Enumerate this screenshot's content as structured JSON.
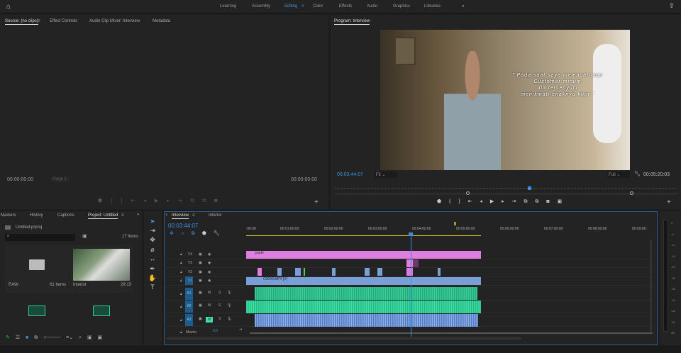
{
  "workspaces": [
    "Learning",
    "Assembly",
    "Editing",
    "Color",
    "Effects",
    "Audio",
    "Graphics",
    "Libraries"
  ],
  "active_workspace": "Editing",
  "source_panel": {
    "tabs": [
      "Source: (no clips)",
      "Effect Controls",
      "Audio Clip Mixer: Interview",
      "Metadata"
    ],
    "timecode_left": "00:00:00:00",
    "timecode_right": "00:00:00:00",
    "page": "Page 1"
  },
  "program_panel": {
    "title": "Program: Interview",
    "timecode": "00:03:44:07",
    "fit": "Fit",
    "quality": "Full",
    "duration": "00:05:20:03",
    "subtitle": [
      "\" Pada saat saya membuat kopi",
      "Customer minum",
      "dia tersenyum",
      "menikmati enaknya kopi \""
    ]
  },
  "project_panel": {
    "tabs": [
      "Markers",
      "History",
      "Captions",
      "Project: Untitled"
    ],
    "file": "Untitled.prproj",
    "items_count": "17 Items",
    "items": [
      {
        "name": "RAW",
        "meta": "61 Items"
      },
      {
        "name": "Interior",
        "meta": "29:13"
      }
    ]
  },
  "timeline": {
    "tabs": [
      "Interview",
      "Interior"
    ],
    "timecode": "00:03:44:07",
    "ruler": [
      ":00:00",
      "00:01:00:00",
      "00:02:00:00",
      "00:03:00:00",
      "00:04:00:00",
      "00:05:00:00",
      "00:06:00:00",
      "00:07:00:00",
      "00:08:00:00",
      "00:09:00:"
    ],
    "video_tracks": [
      "V4",
      "V3",
      "V2",
      "V1"
    ],
    "audio_tracks": [
      "A1",
      "A2",
      "A3"
    ],
    "master": "Master",
    "master_value": "0.0",
    "clip_grade": "grade",
    "clip_v1": "C0090.MP4 [V]",
    "mute": "M",
    "solo": "S"
  },
  "meter": {
    "scale": [
      "0",
      "-6",
      "-12",
      "-18",
      "-24",
      "-30",
      "-36",
      "-42",
      "-48",
      "-54",
      "dB"
    ]
  },
  "colors": {
    "accent": "#4a90e2",
    "grade": "#e07de0",
    "v1": "#7a9fd6",
    "audio": "#2fcf95"
  }
}
